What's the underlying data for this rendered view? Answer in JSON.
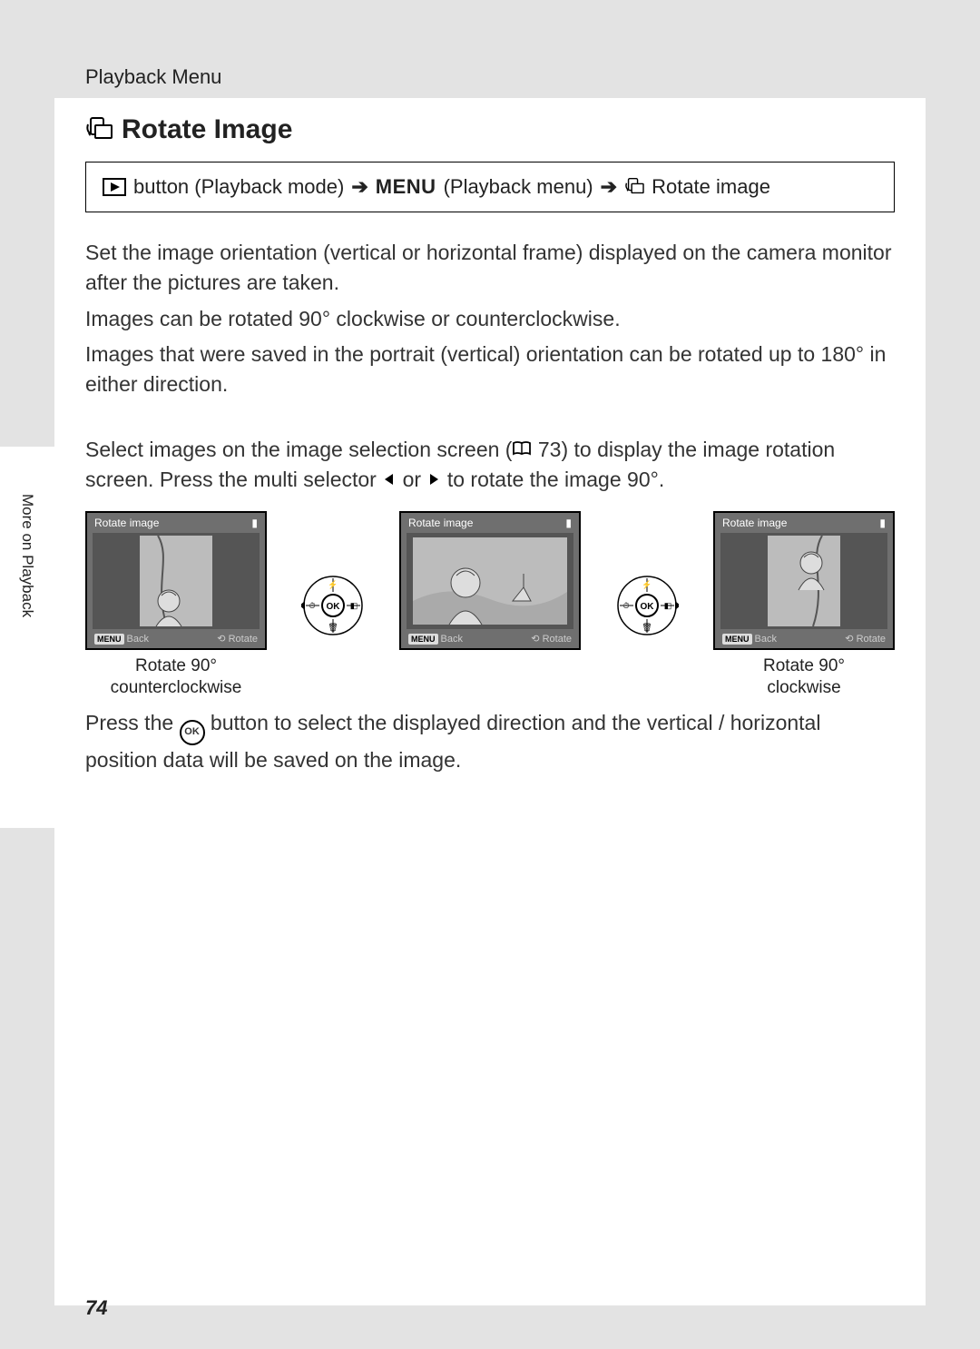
{
  "header": {
    "section": "Playback Menu"
  },
  "title": "Rotate Image",
  "nav": {
    "step1": "button (Playback mode)",
    "menu_word": "MENU",
    "step2": "(Playback menu)",
    "step3": "Rotate image"
  },
  "paragraphs": {
    "p1": "Set the image orientation (vertical or horizontal frame) displayed on the camera monitor after the pictures are taken.",
    "p2": "Images can be rotated 90° clockwise or counterclockwise.",
    "p3": "Images that were saved in the portrait (vertical) orientation can be rotated up to 180° in either direction.",
    "p4a": "Select images on the image selection screen (",
    "p4_ref": " 73",
    "p4b": ") to display the image rotation screen. Press the multi selector ",
    "p4c": " or ",
    "p4d": " to rotate the image 90°.",
    "p5a": "Press the ",
    "p5_ok": "OK",
    "p5b": " button to select the displayed direction and the vertical / horizontal position data will be saved on the image."
  },
  "screens": {
    "title": "Rotate image",
    "back": "Back",
    "rotate": "Rotate",
    "menu_tag": "MENU"
  },
  "captions": {
    "left_l1": "Rotate 90°",
    "left_l2": "counterclockwise",
    "right_l1": "Rotate 90°",
    "right_l2": "clockwise"
  },
  "side_tab": "More on Playback",
  "page_number": "74"
}
